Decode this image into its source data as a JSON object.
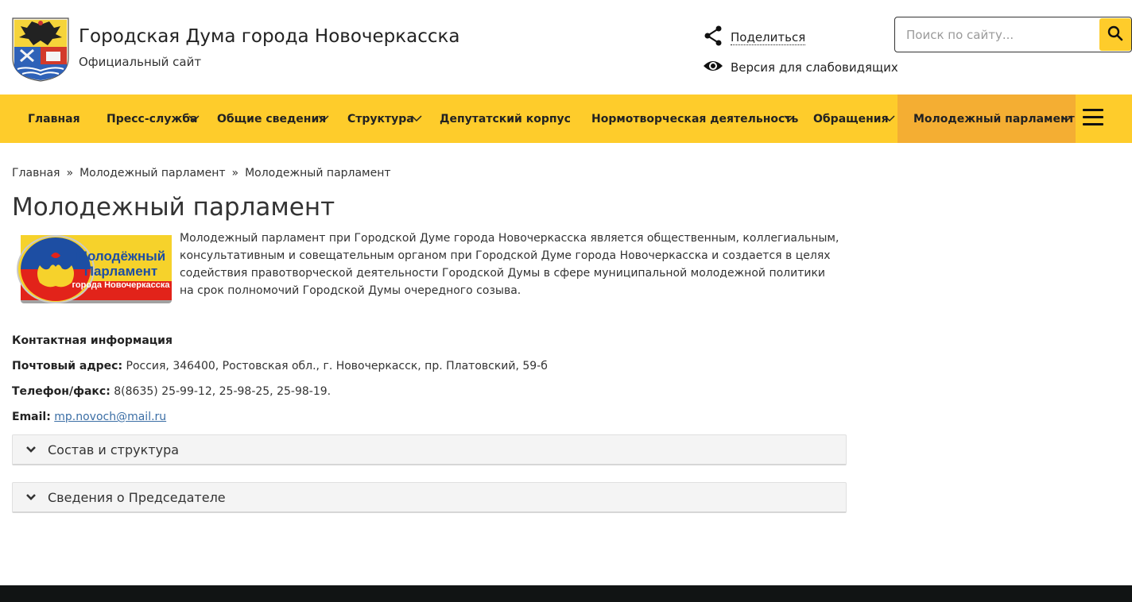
{
  "header": {
    "title": "Городская Дума города Новочеркасска",
    "subtitle": "Официальный сайт",
    "share_label": "Поделиться",
    "low_vision_label": "Версия для слабовидящих",
    "search_placeholder": "Поиск по сайту..."
  },
  "nav": {
    "items": [
      {
        "label": "Главная"
      },
      {
        "label": "Пресс-служба"
      },
      {
        "label": "Общие сведения"
      },
      {
        "label": "Структура"
      },
      {
        "label": "Депутатский корпус"
      },
      {
        "label": "Нормотворческая деятельность"
      },
      {
        "label": "Обращения"
      },
      {
        "label": "Молодежный парламент"
      }
    ],
    "active_color": "#f4ae33",
    "bar_color": "#fecc2b"
  },
  "breadcrumb": [
    "Главная",
    "Молодежный парламент",
    "Молодежный парламент"
  ],
  "page": {
    "title": "Молодежный парламент",
    "logo_text": [
      "Молодёжный",
      "Парламент",
      "города Новочеркасска"
    ],
    "intro": "Молодежный парламент при Городской Думе города Новочеркасска является общественным, коллегиальным, консультативным и совещательным органом при Городской Думе города Новочеркасска и создается в целях содействия правотворческой деятельности Городской Думы в сфере муниципальной молодежной политики на срок полномочий Городской Думы очередного созыва."
  },
  "contacts": {
    "title": "Контактная информация",
    "address_label": "Почтовый адрес:",
    "address_value": " Россия, 346400, Ростовская обл., г. Новочеркасск, пр. Платовский, 59-б",
    "phone_label": "Телефон/факс:",
    "phone_value": " 8(8635) 25-99-12, 25-98-25, 25-98-19.",
    "email_label": "Email:",
    "email_value": "mp.novoch@mail.ru"
  },
  "accordion": [
    {
      "label": "Состав и структура"
    },
    {
      "label": "Сведения о Председателе"
    }
  ]
}
